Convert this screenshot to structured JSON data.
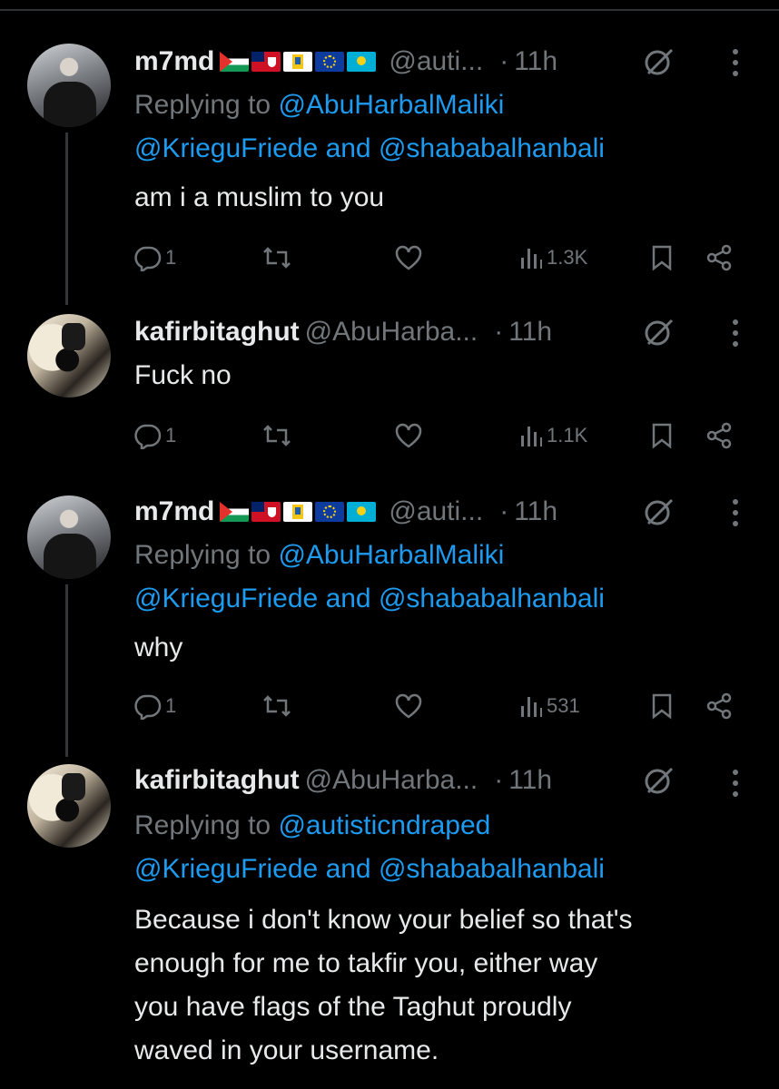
{
  "tweets": [
    {
      "name": "m7md",
      "flags": [
        "palestine-flag",
        "bermuda-flag",
        "us-virgin-islands-flag",
        "eu-flag",
        "kazakhstan-flag"
      ],
      "handle": "@auti...",
      "dot": "·",
      "time": "11h",
      "reply_prefix": "Replying to",
      "reply_link1": "@AbuHarbalMaliki",
      "reply_link2": "@KrieguFriede",
      "reply_and": "and",
      "reply_link3": "@shababalhanbali",
      "text": "am i a muslim to you",
      "replies": "1",
      "views": "1.3K"
    },
    {
      "name": "kafirbitaghut",
      "handle": "@AbuHarba...",
      "dot": "·",
      "time": "11h",
      "text": "Fuck no",
      "replies": "1",
      "views": "1.1K"
    },
    {
      "name": "m7md",
      "flags": [
        "palestine-flag",
        "bermuda-flag",
        "us-virgin-islands-flag",
        "eu-flag",
        "kazakhstan-flag"
      ],
      "handle": "@auti...",
      "dot": "·",
      "time": "11h",
      "reply_prefix": "Replying to",
      "reply_link1": "@AbuHarbalMaliki",
      "reply_link2": "@KrieguFriede",
      "reply_and": "and",
      "reply_link3": "@shababalhanbali",
      "text": "why",
      "replies": "1",
      "views": "531"
    },
    {
      "name": "kafirbitaghut",
      "handle": "@AbuHarba...",
      "dot": "·",
      "time": "11h",
      "reply_prefix": "Replying to",
      "reply_link1": "@autisticndraped",
      "reply_link2": "@KrieguFriede",
      "reply_and": "and",
      "reply_link3": "@shababalhanbali",
      "text_lines": [
        "Because i don't know your belief so that's",
        "enough for me to takfir you, either way",
        "you have flags of the Taghut proudly",
        "waved in your username."
      ]
    }
  ],
  "colors": {
    "background": "#000000",
    "text": "#e7e9ea",
    "secondary": "#71767b",
    "link": "#1d9bf0",
    "thread_line": "#333639"
  }
}
